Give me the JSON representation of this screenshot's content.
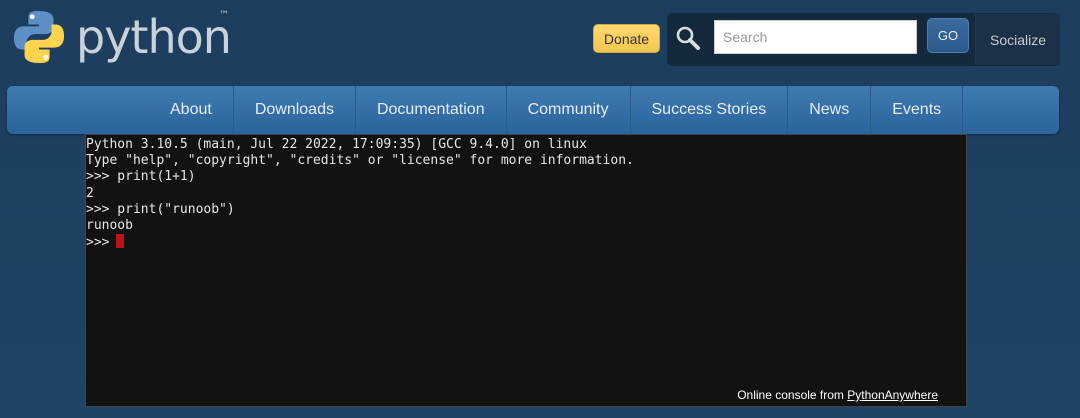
{
  "brand": {
    "name": "python",
    "trademark": "™"
  },
  "header": {
    "donate_label": "Donate",
    "search_placeholder": "Search",
    "go_label": "GO",
    "socialize_label": "Socialize"
  },
  "nav": {
    "items": [
      {
        "label": "About"
      },
      {
        "label": "Downloads"
      },
      {
        "label": "Documentation"
      },
      {
        "label": "Community"
      },
      {
        "label": "Success Stories"
      },
      {
        "label": "News"
      },
      {
        "label": "Events"
      }
    ]
  },
  "console": {
    "lines": [
      "Python 3.10.5 (main, Jul 22 2022, 17:09:35) [GCC 9.4.0] on linux",
      "Type \"help\", \"copyright\", \"credits\" or \"license\" for more information.",
      ">>> print(1+1)",
      "2",
      ">>> print(\"runoob\")",
      "runoob"
    ],
    "prompt": ">>>",
    "credit_text": "Online console from ",
    "credit_link": "PythonAnywhere"
  },
  "colors": {
    "background": "#1f4466",
    "nav_bar": "#3472a8",
    "donate": "#ffd870",
    "console_bg": "#121212",
    "cursor": "#c0121a"
  },
  "icons": {
    "logo": "python-logo-icon",
    "search": "magnifier-icon"
  }
}
